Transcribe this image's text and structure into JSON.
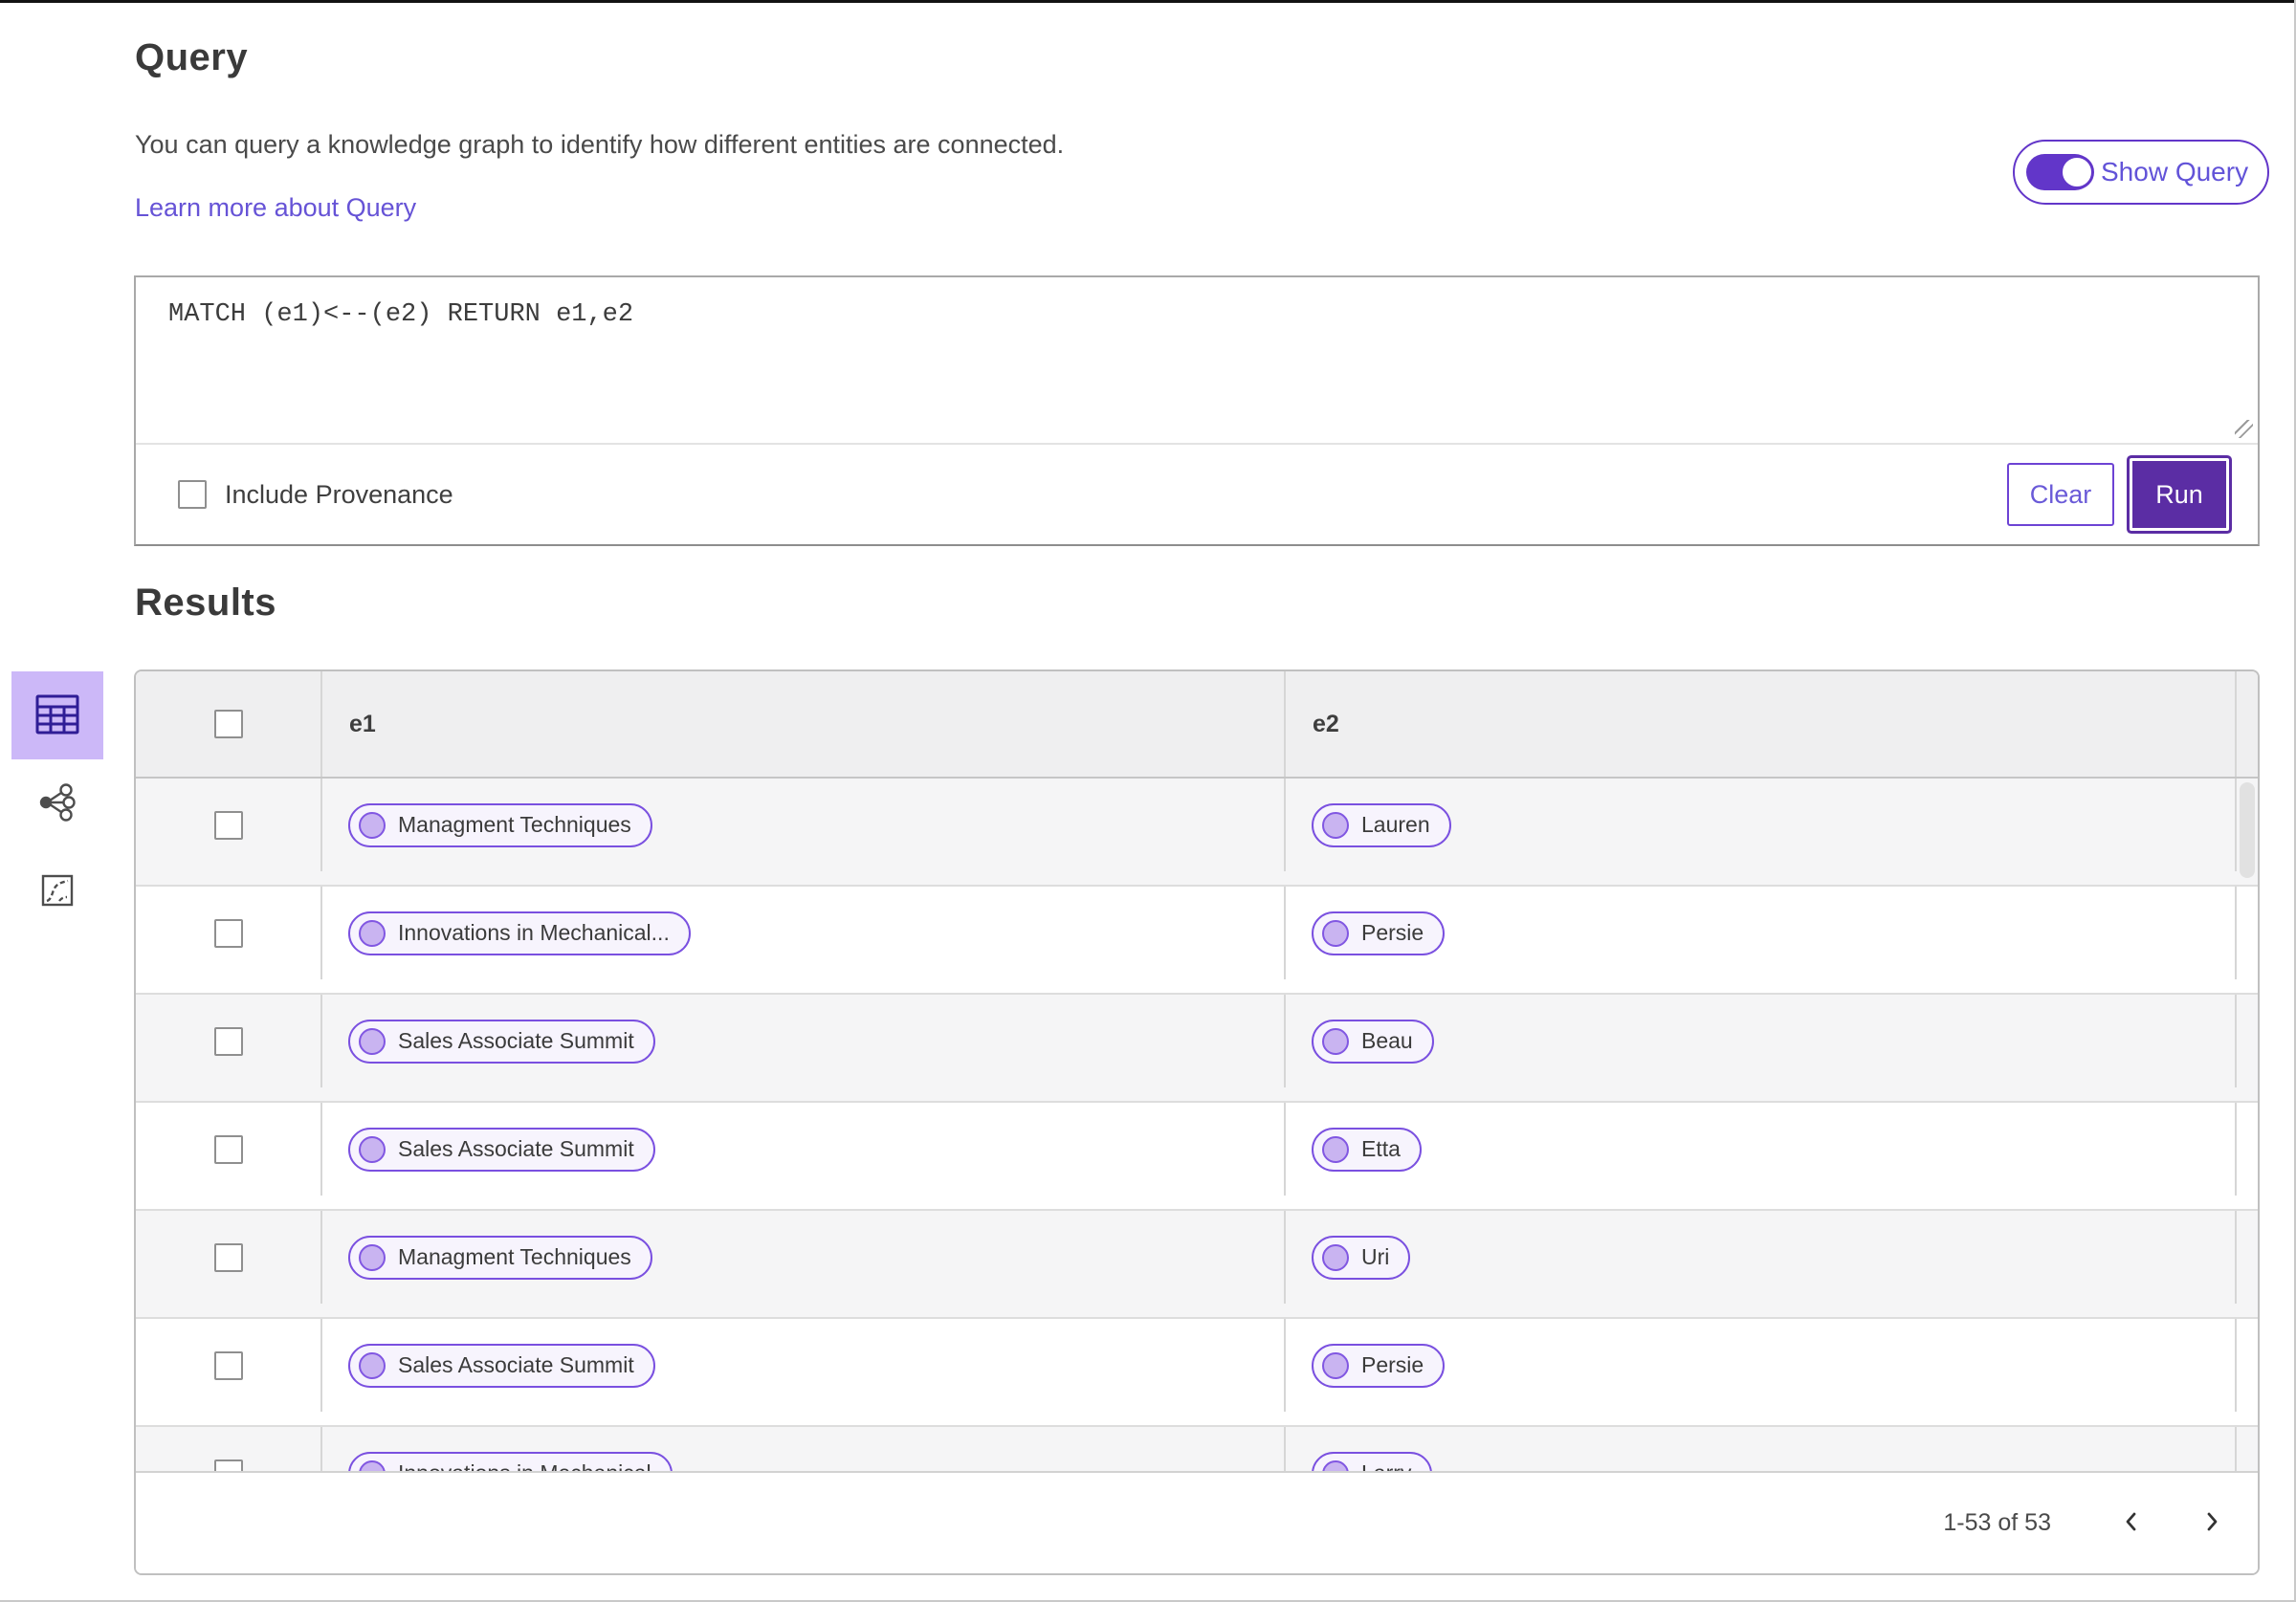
{
  "header": {
    "title": "Query",
    "description": "You can query a knowledge graph to identify how different entities are connected.",
    "learn_more": "Learn more about Query",
    "show_query_label": "Show Query",
    "show_query_on": true
  },
  "query_editor": {
    "value": "MATCH (e1)<--(e2) RETURN e1,e2",
    "include_provenance_label": "Include Provenance",
    "include_provenance_checked": false,
    "clear_label": "Clear",
    "run_label": "Run"
  },
  "results": {
    "title": "Results",
    "columns": [
      "e1",
      "e2"
    ],
    "rows": [
      {
        "e1": "Managment Techniques",
        "e2": "Lauren"
      },
      {
        "e1": "Innovations in Mechanical...",
        "e2": "Persie"
      },
      {
        "e1": "Sales Associate Summit",
        "e2": "Beau"
      },
      {
        "e1": "Sales Associate Summit",
        "e2": "Etta"
      },
      {
        "e1": "Managment Techniques",
        "e2": "Uri"
      },
      {
        "e1": "Sales Associate Summit",
        "e2": "Persie"
      },
      {
        "e1": "Innovations in Mechanical",
        "e2": "Larry"
      }
    ],
    "view_switcher": {
      "selected": "table-view",
      "icons": [
        "table-view-icon",
        "network-graph-icon",
        "chart-curve-icon"
      ]
    },
    "pagination": {
      "range_label": "1-53 of 53",
      "icons": [
        "chevron-left-icon",
        "chevron-right-icon"
      ]
    }
  },
  "colors": {
    "accent": "#6236c9",
    "accent_dark": "#5b2da4",
    "link": "#6653d6",
    "pill_border": "#7a50e0",
    "pill_bg": "#f7f4fd",
    "pill_dot": "#c9b4f1",
    "selected_view_bg": "#ccb8f8",
    "selected_view_icon": "#2f1d96",
    "row_alt": "#f5f5f6",
    "header_bg": "#efeff0"
  }
}
